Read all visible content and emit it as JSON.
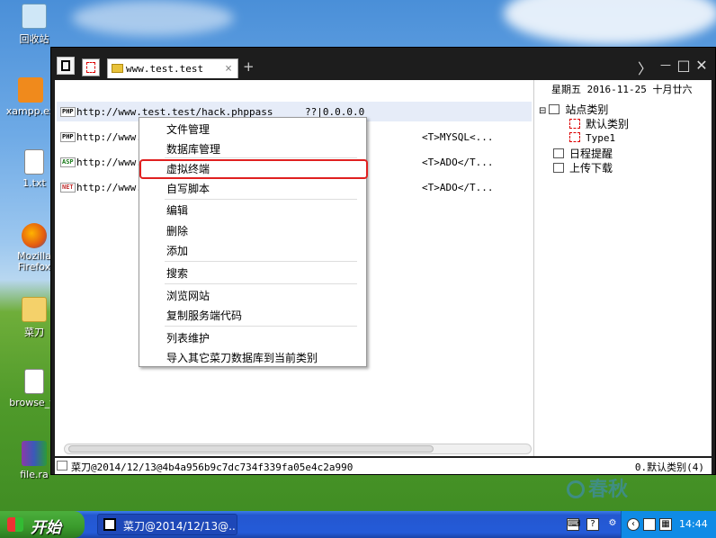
{
  "desktop": {
    "icons": [
      {
        "label": "回收站"
      },
      {
        "label": "xampp.ex"
      },
      {
        "label": "1.txt"
      },
      {
        "label": "Mozilla Firefox"
      },
      {
        "label": "菜刀"
      },
      {
        "label": "browse_fo"
      },
      {
        "label": "file.ra"
      }
    ]
  },
  "window": {
    "tab_label": "www.test.test",
    "tab_close": "×",
    "new_tab": "+",
    "controls": {
      "more": "〉",
      "minimize": "—",
      "maximize": "□",
      "close": "✕"
    }
  },
  "list": {
    "rows": [
      {
        "type": "PHP",
        "url": "http://www.test.test/hack.php",
        "password": "pass",
        "ip": "??|0.0.0.0",
        "config": ""
      },
      {
        "type": "PHP",
        "url": "http://www.m",
        "password": "",
        "ip": "",
        "config": "<T>MYSQL<..."
      },
      {
        "type": "ASP",
        "url": "http://www.m",
        "password": "",
        "ip": "",
        "config": "<T>ADO</T..."
      },
      {
        "type": "NET",
        "url": "http://www.m",
        "password": "",
        "ip": "",
        "config": "<T>ADO</T..."
      }
    ]
  },
  "sidebar": {
    "date": "星期五 2016-11-25 十月廿六",
    "tree": {
      "root": "站点类别",
      "children": [
        "默认类别",
        "Type1"
      ],
      "schedule": "日程提醒",
      "upload": "上传下载"
    }
  },
  "context_menu": {
    "items": [
      "文件管理",
      "数据库管理",
      "虚拟终端",
      "自写脚本",
      "编辑",
      "删除",
      "添加",
      "搜索",
      "浏览网站",
      "复制服务端代码",
      "列表维护",
      "导入其它菜刀数据库到当前类别"
    ],
    "highlighted": "虚拟终端"
  },
  "statusbar": {
    "left": "菜刀@2014/12/13@4b4a956b9c7dc734f339fa05e4c2a990",
    "right": "0.默认类别(4)"
  },
  "watermark": "春秋",
  "taskbar": {
    "start_label": "开始",
    "task_label": "菜刀@2014/12/13@...",
    "clock": "14:44"
  },
  "colors": {
    "highlight_border": "#e02020",
    "window_frame": "#1d1d1d",
    "taskbar": "#245bd8",
    "start_button": "#3a9a2c"
  }
}
